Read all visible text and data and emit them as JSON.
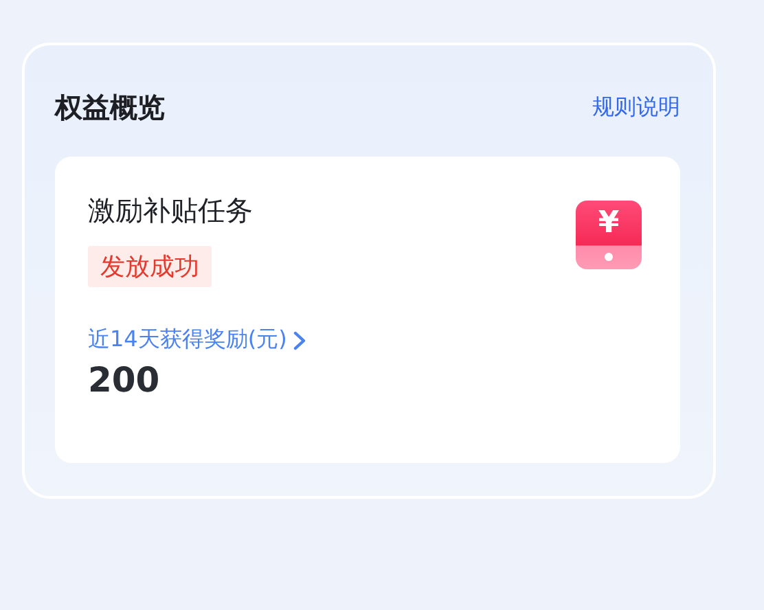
{
  "panel": {
    "title": "权益概览",
    "link": "规则说明"
  },
  "task_card": {
    "title": "激励补贴任务",
    "status": "发放成功",
    "icon_symbol": "¥",
    "reward_label": "近14天获得奖励(元)",
    "reward_value": "200"
  }
}
